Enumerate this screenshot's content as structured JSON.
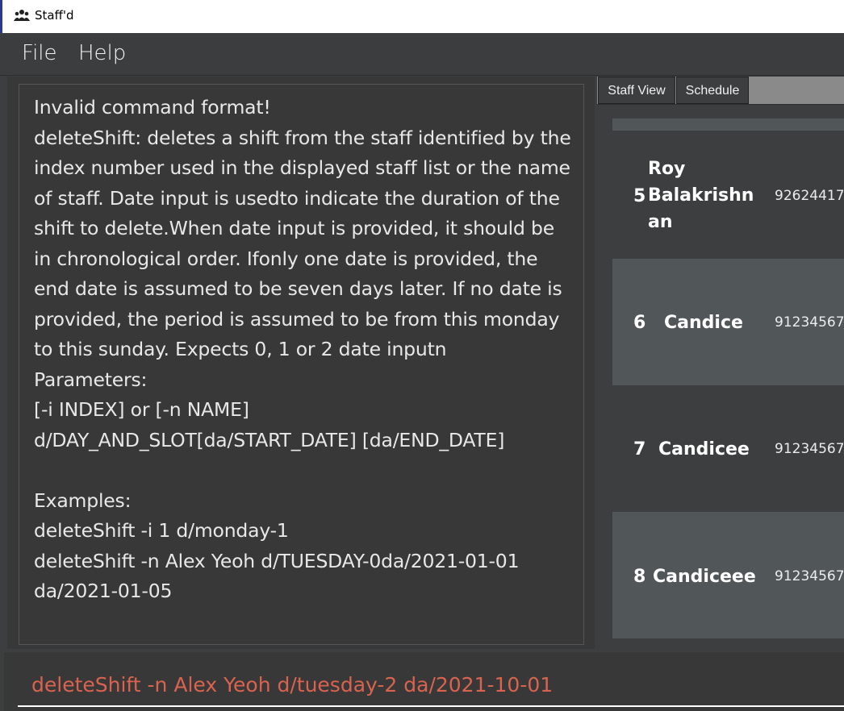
{
  "window": {
    "title": "Staff'd",
    "icon": "people-icon"
  },
  "menu": {
    "file_label": "File",
    "help_label": "Help"
  },
  "result": {
    "text": "Invalid command format!\ndeleteShift: deletes a shift from the staff identified by the index number used in the displayed staff list or the name of staff. Date input is usedto indicate the duration of the shift to delete.When date input is provided, it should be in chronological order. Ifonly one date is provided, the end date is assumed to be seven days later. If no date is provided, the period is assumed to be from this monday to this sunday. Expects 0, 1 or 2 date inputn\nParameters:\n[-i INDEX] or [-n NAME]\nd/DAY_AND_SLOT[da/START_DATE] [da/END_DATE]\n\nExamples:\ndeleteShift -i 1 d/monday-1\ndeleteShift -n Alex Yeoh d/TUESDAY-0da/2021-01-01 da/2021-01-05"
  },
  "tabs": {
    "staff_view": "Staff View",
    "schedule": "Schedule"
  },
  "staff_list": [
    {
      "index": "5",
      "name": "Roy Balakrishn an",
      "phone": "92624417"
    },
    {
      "index": "6",
      "name": "Candice",
      "phone": "91234567"
    },
    {
      "index": "7",
      "name": "Candicee",
      "phone": "91234567"
    },
    {
      "index": "8",
      "name": "Candiceee",
      "phone": "91234567"
    }
  ],
  "command": {
    "value": "deleteShift -n Alex Yeoh d/tuesday-2 da/2021-10-01"
  },
  "colors": {
    "background": "#3c3e40",
    "card_light": "#515658",
    "command_error_text": "#d9634f"
  }
}
